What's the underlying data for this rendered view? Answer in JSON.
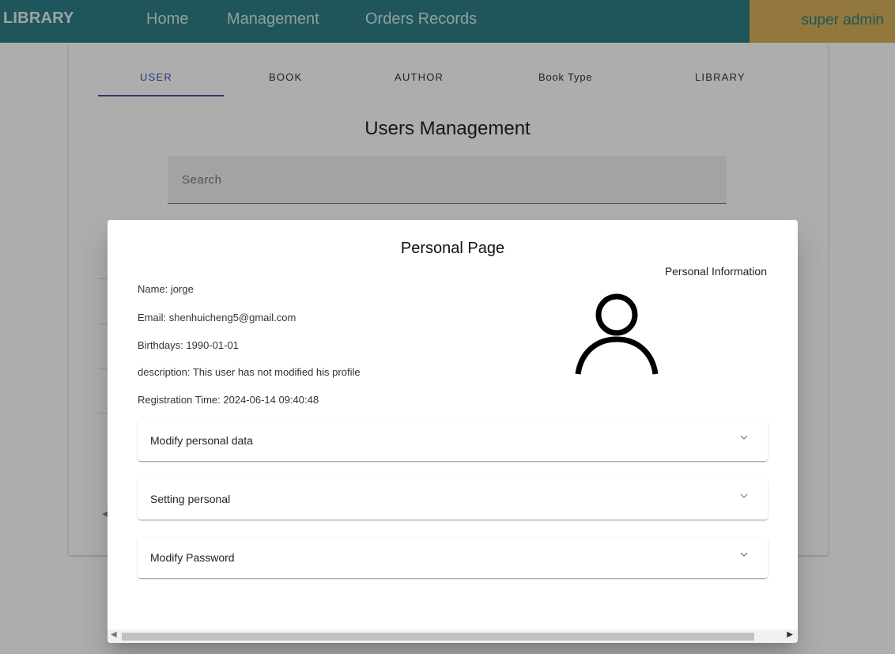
{
  "navbar": {
    "brand": "LIBRARY",
    "links": [
      "Home",
      "Management",
      "Orders Records"
    ],
    "user": "super admin",
    "colors": {
      "bar": "#2e7f86",
      "user_block": "#d8b15a"
    }
  },
  "tabs": [
    "USER",
    "BOOK",
    "AUTHOR",
    "Book Type",
    "LIBRARY"
  ],
  "active_tab": "USER",
  "page_title": "Users Management",
  "search": {
    "placeholder": "Search"
  },
  "modal": {
    "title": "Personal Page",
    "info_heading": "Personal Information",
    "info": [
      "Name: jorge",
      "Email: shenhuicheng5@gmail.com",
      "Birthdays: 1990-01-01",
      "description: This user has not modified his profile",
      "Registration Time: 2024-06-14 09:40:48"
    ],
    "avatar_icon": "user-outline-icon",
    "panels": [
      "Modify personal data",
      "Setting personal",
      "Modify Password"
    ],
    "chevron_icon": "chevron-down-icon"
  }
}
